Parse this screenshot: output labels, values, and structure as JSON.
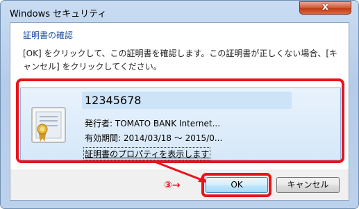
{
  "window": {
    "title": "Windows セキュリティ",
    "close_label": "x"
  },
  "dialog": {
    "heading": "証明書の確認",
    "message": "[OK] をクリックして、この証明書を確認します。この証明書が正しくない場合、[キャンセル] をクリックしてください。"
  },
  "certificate": {
    "name": "12345678",
    "issuer": "発行者: TOMATO BANK Internet...",
    "validity": "有効期間: 2014/03/18 ～ 2015/0...",
    "properties_link": "証明書のプロパティを表示します",
    "icon": "certificate-icon"
  },
  "buttons": {
    "ok_label": "OK",
    "cancel_label": "キャンセル"
  },
  "annotation": {
    "step_label": "③→",
    "highlight_color": "#e8141a"
  }
}
